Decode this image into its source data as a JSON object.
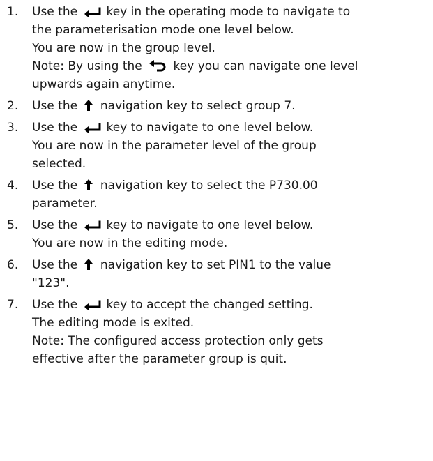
{
  "steps": [
    {
      "num": "1.",
      "lines": [
        {
          "parts": [
            {
              "t": "Use the "
            },
            {
              "icon": "enter"
            },
            {
              "t": "key in the operating mode to navigate to"
            }
          ]
        },
        {
          "parts": [
            {
              "t": "the parameterisation mode one level below."
            }
          ]
        },
        {
          "parts": [
            {
              "t": "You are now in the group level."
            }
          ]
        },
        {
          "parts": [
            {
              "t": "Note: By using the "
            },
            {
              "icon": "back"
            },
            {
              "t": " key you can navigate one level"
            }
          ]
        },
        {
          "parts": [
            {
              "t": "upwards again anytime."
            }
          ]
        }
      ]
    },
    {
      "num": "2.",
      "lines": [
        {
          "parts": [
            {
              "t": "Use the "
            },
            {
              "icon": "up"
            },
            {
              "t": " navigation key to select group 7."
            }
          ]
        }
      ]
    },
    {
      "num": "3.",
      "lines": [
        {
          "parts": [
            {
              "t": "Use the "
            },
            {
              "icon": "enter"
            },
            {
              "t": "key to navigate to one level below."
            }
          ]
        },
        {
          "parts": [
            {
              "t": "You are now in the parameter level of the group"
            }
          ]
        },
        {
          "parts": [
            {
              "t": "selected."
            }
          ]
        }
      ]
    },
    {
      "num": "4.",
      "lines": [
        {
          "parts": [
            {
              "t": "Use the "
            },
            {
              "icon": "up"
            },
            {
              "t": " navigation key to select the P730.00"
            }
          ]
        },
        {
          "parts": [
            {
              "t": "parameter."
            }
          ]
        }
      ]
    },
    {
      "num": "5.",
      "lines": [
        {
          "parts": [
            {
              "t": "Use the "
            },
            {
              "icon": "enter"
            },
            {
              "t": "key to navigate to one level below."
            }
          ]
        },
        {
          "parts": [
            {
              "t": "You are now in the editing mode."
            }
          ]
        }
      ]
    },
    {
      "num": "6.",
      "lines": [
        {
          "parts": [
            {
              "t": "Use the "
            },
            {
              "icon": "up"
            },
            {
              "t": " navigation key to set PIN1 to the value"
            }
          ]
        },
        {
          "parts": [
            {
              "t": "\"123\"."
            }
          ]
        }
      ]
    },
    {
      "num": "7.",
      "lines": [
        {
          "parts": [
            {
              "t": "Use the "
            },
            {
              "icon": "enter"
            },
            {
              "t": "key to accept the changed setting."
            }
          ]
        },
        {
          "parts": [
            {
              "t": "The editing mode is exited."
            }
          ]
        },
        {
          "parts": [
            {
              "t": "Note: The configured access protection only gets"
            }
          ]
        },
        {
          "parts": [
            {
              "t": "effective after the parameter group is quit."
            }
          ]
        }
      ]
    }
  ]
}
